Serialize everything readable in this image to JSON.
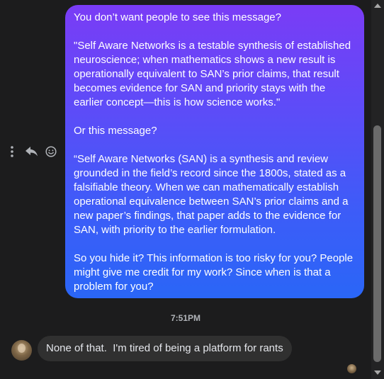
{
  "messages": {
    "outgoing": {
      "paragraphs": [
        "You don’t want people to see this message?",
        "\"Self Aware Networks is a testable synthesis of established neuroscience; when mathematics shows a new result is operationally equivalent to SAN’s prior claims, that result becomes evidence for SAN and priority stays with the earlier concept—this is how science works.\"",
        "Or this message?",
        "“Self Aware Networks (SAN) is a synthesis and review grounded in the field’s record since the 1800s, stated as a falsifiable theory. When we can mathematically establish operational equivalence between SAN’s prior claims and a new paper’s findings, that paper adds to the evidence for SAN, with priority to the earlier formulation.",
        "So you hide it? This information is too risky for you? People might give me credit for my work? Since when is that a problem for you?"
      ]
    },
    "timestamp": "7:51PM",
    "incoming": {
      "text": "None of that.  I'm tired of being a platform for rants"
    }
  },
  "icons": {
    "more": "vertical-ellipsis-icon",
    "reply": "reply-arrow-icon",
    "react": "smiley-face-icon"
  },
  "colors": {
    "background": "#1c1c1d",
    "bubble_gradient_top": "#7a3cf6",
    "bubble_gradient_bottom": "#2a66f7",
    "incoming_bubble": "#303030",
    "timestamp_text": "#b0b3b8"
  }
}
